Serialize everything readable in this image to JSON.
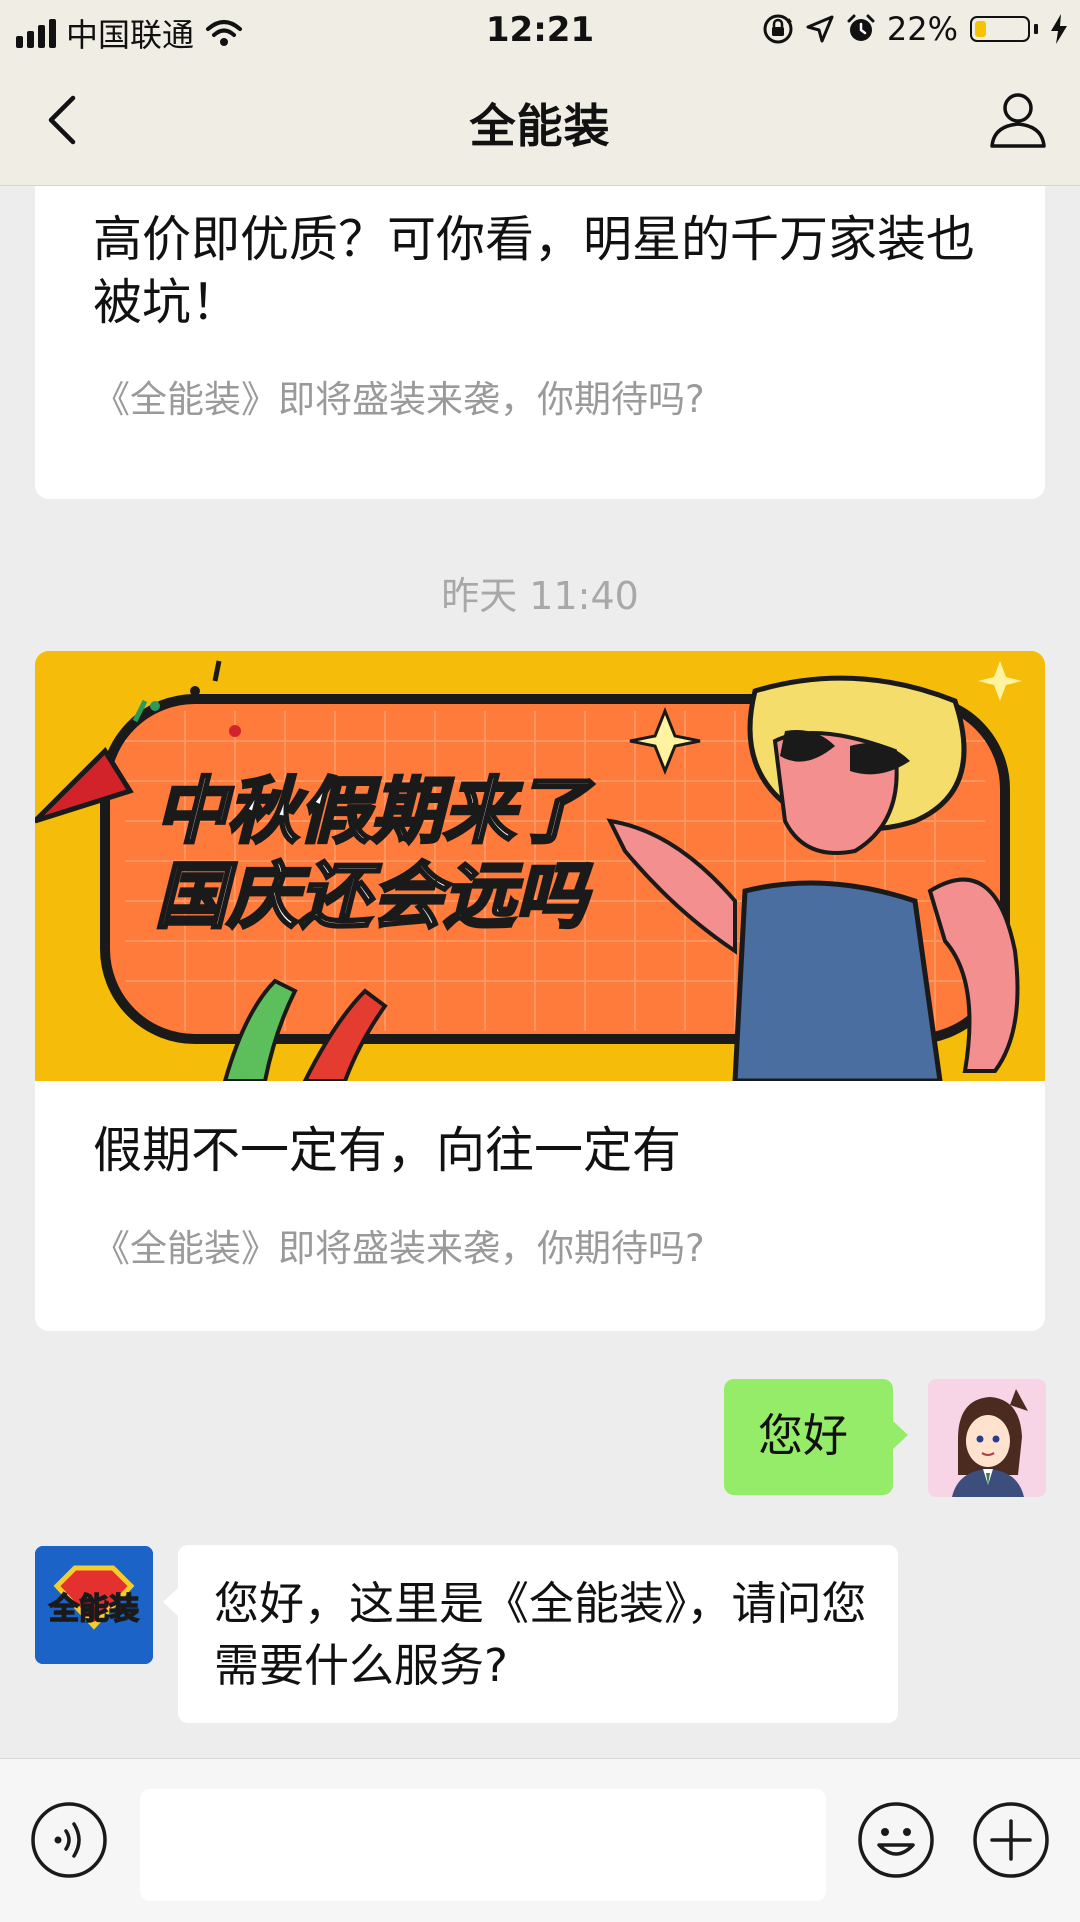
{
  "status_bar": {
    "carrier": "中国联通",
    "time": "12:21",
    "battery": "22%",
    "battery_level": 0.22,
    "icons": [
      "signal-icon",
      "wifi-icon",
      "rotation-lock-icon",
      "location-icon",
      "alarm-icon",
      "battery-icon",
      "charging-icon"
    ]
  },
  "header": {
    "title": "全能装",
    "back_icon": "back-icon",
    "profile_icon": "profile-icon"
  },
  "messages": {
    "card1": {
      "title": "高价即优质？可你看，明星的千万家装也被坑！",
      "description": "《全能装》即将盛装来袭，你期待吗?"
    },
    "timestamp": "昨天 11:40",
    "card2": {
      "banner_text_line1": "中秋假期来了",
      "banner_text_line2": "国庆还会远吗",
      "title": "假期不一定有，向往一定有",
      "description": "《全能装》即将盛装来袭，你期待吗?"
    },
    "outgoing": {
      "text": "您好"
    },
    "incoming": {
      "text": "您好，这里是《全能装》，请问您需要什么服务?",
      "brand_avatar_text": "全能装"
    }
  },
  "input_bar": {
    "voice_icon": "voice-icon",
    "text_value": "",
    "emoji_icon": "emoji-icon",
    "add_icon": "plus-icon"
  },
  "colors": {
    "accent_green": "#95ec69",
    "background": "#ededed",
    "header_bg": "#efede4",
    "banner_yellow": "#f5bd0a",
    "banner_orange": "#ff7b3b",
    "brand_blue": "#1b63c7"
  }
}
